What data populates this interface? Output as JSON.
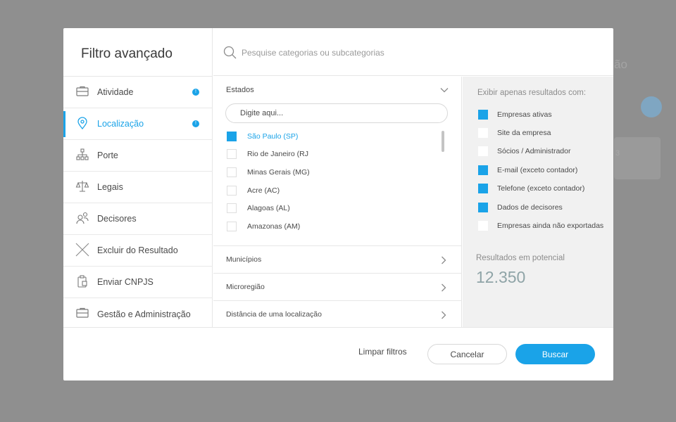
{
  "background": {
    "ghost_text": "ão",
    "ghost_card_text": "3"
  },
  "modal": {
    "title": "Filtro avançado",
    "search": {
      "placeholder": "Pesquise categorias ou subcategorias",
      "icon": "search-icon"
    },
    "sidebar": {
      "items": [
        {
          "label": "Atividade",
          "icon": "briefcase-icon",
          "badge": "!",
          "active": false
        },
        {
          "label": "Localização",
          "icon": "location-pin-icon",
          "badge": "!",
          "active": true
        },
        {
          "label": "Porte",
          "icon": "org-chart-icon",
          "badge": "",
          "active": false
        },
        {
          "label": "Legais",
          "icon": "scales-icon",
          "badge": "",
          "active": false
        },
        {
          "label": "Decisores",
          "icon": "users-icon",
          "badge": "",
          "active": false
        },
        {
          "label": "Excluir do Resultado",
          "icon": "close-icon",
          "badge": "",
          "active": false
        },
        {
          "label": "Enviar CNPJS",
          "icon": "clipboard-icon",
          "badge": "",
          "active": false
        },
        {
          "label": "Gestão e Administração",
          "icon": "briefcase-icon",
          "badge": "",
          "active": false
        }
      ]
    },
    "estados": {
      "label": "Estados",
      "filter_placeholder": "Digite aqui...",
      "items": [
        {
          "label": "São Paulo (SP)",
          "checked": true
        },
        {
          "label": "Rio de Janeiro (RJ",
          "checked": false
        },
        {
          "label": "Minas Gerais (MG)",
          "checked": false
        },
        {
          "label": "Acre (AC)",
          "checked": false
        },
        {
          "label": "Alagoas (AL)",
          "checked": false
        },
        {
          "label": "Amazonas (AM)",
          "checked": false
        }
      ]
    },
    "accordions": [
      {
        "label": "Municípios"
      },
      {
        "label": "Microregião"
      },
      {
        "label": "Distância de uma localização"
      }
    ],
    "right_panel": {
      "heading": "Exibir apenas resultados com:",
      "options": [
        {
          "label": "Empresas ativas",
          "checked": true
        },
        {
          "label": "Site da empresa",
          "checked": false
        },
        {
          "label": "Sócios / Administrador",
          "checked": false
        },
        {
          "label": "E-mail (exceto contador)",
          "checked": true
        },
        {
          "label": "Telefone (exceto contador)",
          "checked": true
        },
        {
          "label": "Dados de decisores",
          "checked": true
        },
        {
          "label": "Empresas ainda não exportadas",
          "checked": false
        }
      ],
      "results_label": "Resultados em potencial",
      "results_value": "12.350"
    },
    "footer": {
      "clear_label": "Limpar filtros",
      "cancel_label": "Cancelar",
      "search_label": "Buscar"
    }
  },
  "colors": {
    "accent": "#1aa3e8",
    "overlay": "#8f8f8f",
    "panel": "#f1f1f1",
    "result_value": "#8fa4a7"
  }
}
